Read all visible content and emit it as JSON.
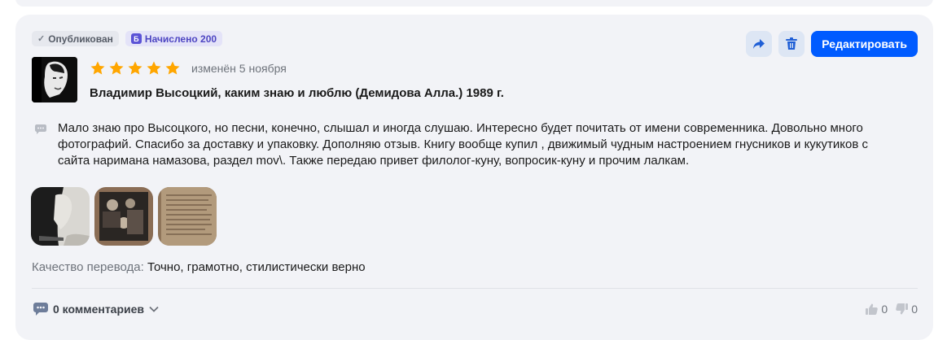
{
  "review": {
    "status_badge": "Опубликован",
    "bonus_badge": "Начислено 200",
    "bonus_icon_letter": "Б",
    "edit_button": "Редактировать",
    "rating": 5,
    "edited_label": "изменён 5 ноября",
    "book_title": "Владимир Высоцкий, каким знаю и люблю (Демидова Алла.) 1989 г.",
    "text": "Мало знаю про Высоцкого, но песни, конечно, слышал и иногда слушаю. Интересно будет почитать от имени современника. Довольно много фотографий. Спасибо за доставку и упаковку. Дополняю отзыв. Книгу вообще купил , движимый чудным настроением гнусников и кукутиков с сайта наримана намазова, раздел mov\\. Также передаю привет филолог-куну, вопросик-куну и прочим лалкам.",
    "photos": [
      "photo-portrait",
      "photo-group",
      "photo-page"
    ],
    "quality_label": "Качество перевода:",
    "quality_value": "Точно, грамотно, стилистически верно",
    "comments_label": "0 комментариев",
    "likes": "0",
    "dislikes": "0"
  },
  "colors": {
    "accent": "#005bff",
    "star": "#ffa600",
    "card_bg": "#f2f3f7"
  },
  "icons": {
    "share": "share-icon",
    "delete": "trash-icon",
    "comment": "comment-icon",
    "like": "thumb-up-icon",
    "dislike": "thumb-down-icon",
    "status": "check-icon",
    "chevron": "chevron-down-icon"
  }
}
